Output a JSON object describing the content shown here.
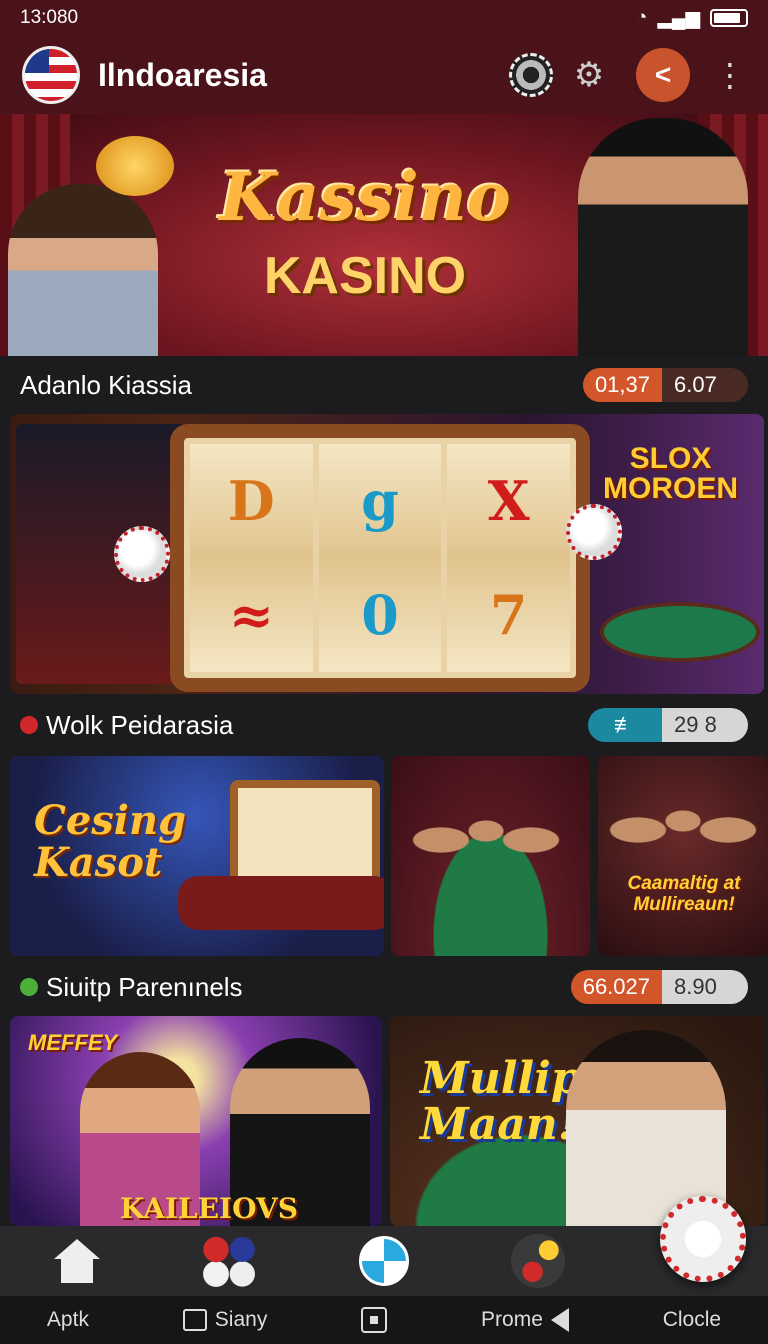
{
  "status_bar": {
    "time": "13:080"
  },
  "header": {
    "title": "Ilndoaresia"
  },
  "hero": {
    "title": "Kassino",
    "subtitle": "KASINO"
  },
  "section1": {
    "title": "Adanlo Kiassia",
    "stat_a": "01,37",
    "stat_b": "6.07"
  },
  "slot_card": {
    "reels": [
      [
        "D",
        "≈"
      ],
      [
        "g",
        "0"
      ],
      [
        "X",
        "7"
      ]
    ],
    "logo_line1": "SLOX",
    "logo_line2": "MOROEN"
  },
  "section2": {
    "title": "Wolk Peidarasia",
    "stat_icon": "≢",
    "stat_value": "29 8"
  },
  "row2": {
    "card1_line1": "Cesing",
    "card1_line2": "Kasot",
    "card3_text": "Caamaltig at Mullireaun!"
  },
  "section3": {
    "title": "Siuitp Parenınels",
    "stat_a": "66.027",
    "stat_b": "8.90"
  },
  "row3": {
    "card1_badge": "MEFFEY",
    "card1_text": "KAILEIOVS",
    "card2_line1": "Mullip",
    "card2_line2": "Maan!"
  },
  "bottom_nav": {
    "items": [
      "home-icon",
      "chips-icon",
      "wheel-icon",
      "chip-stack-icon"
    ]
  },
  "system_nav": {
    "item1": "Aptk",
    "item2": "Siany",
    "item4": "Prome",
    "item5": "Clocle"
  },
  "colors": {
    "header_bg": "#4a1319",
    "accent": "#c9532c",
    "teal": "#1b8aa0"
  }
}
